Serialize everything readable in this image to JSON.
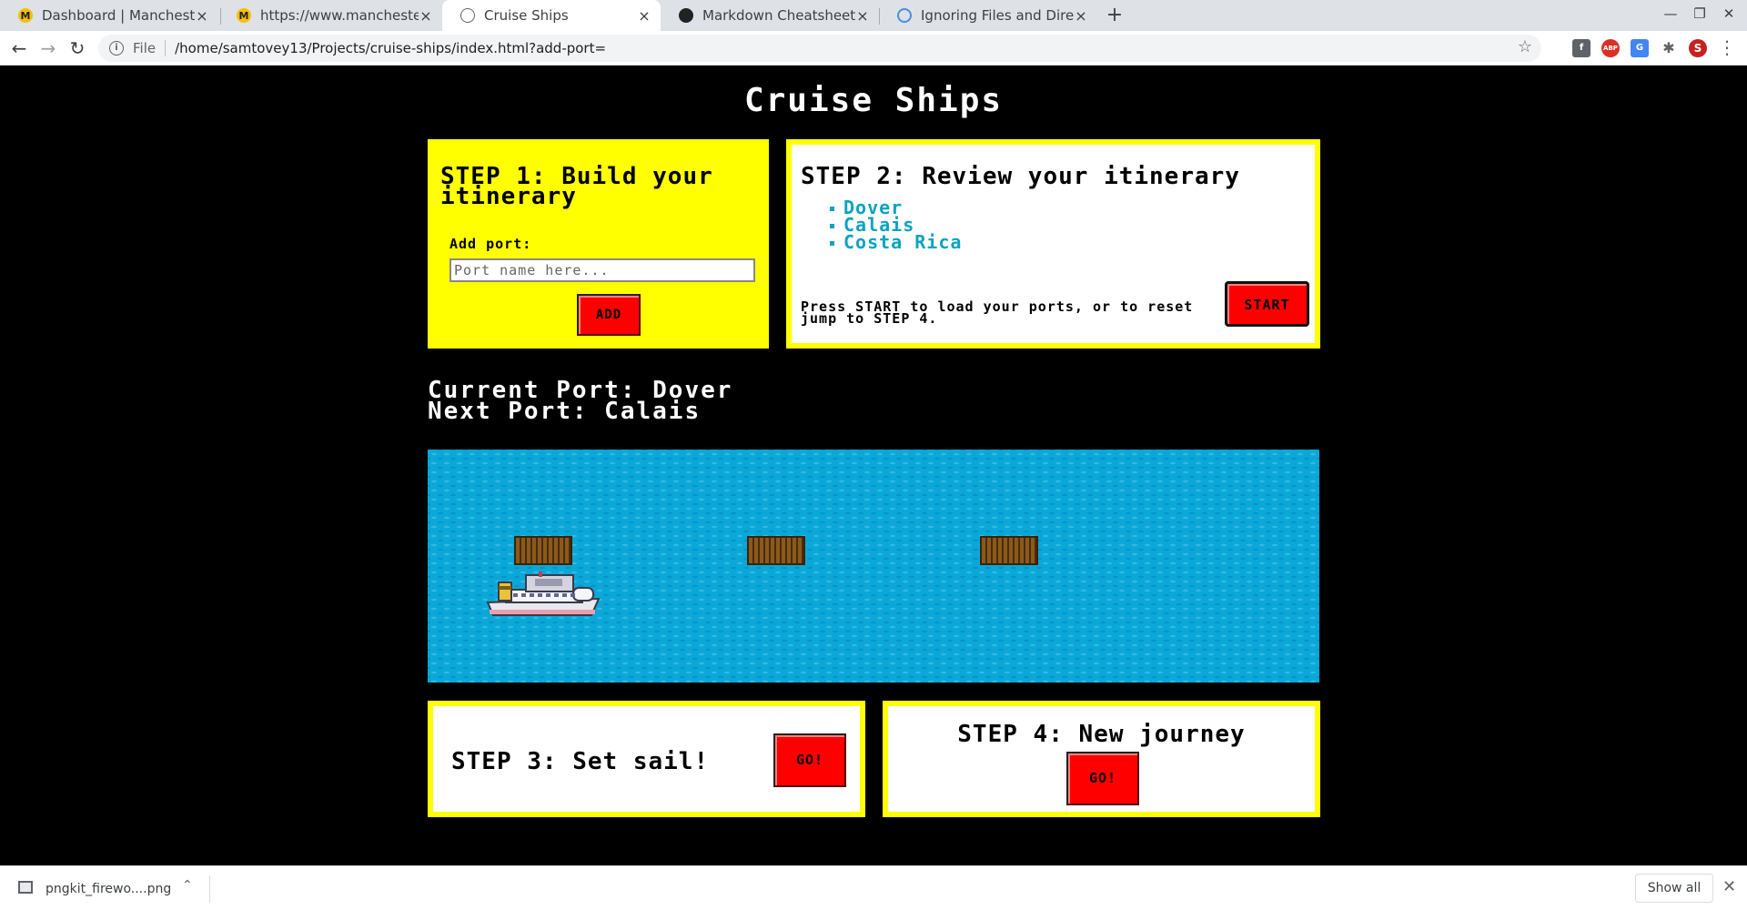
{
  "browser": {
    "tabs": [
      {
        "title": "Dashboard | Manchester Co",
        "favicon": "mcc-logo-icon"
      },
      {
        "title": "https://www.manchesterco",
        "favicon": "mcc-logo-icon"
      },
      {
        "title": "Cruise Ships",
        "favicon": "globe-icon",
        "active": true
      },
      {
        "title": "Markdown Cheatsheet · ad",
        "favicon": "github-icon"
      },
      {
        "title": "Ignoring Files and Director",
        "favicon": "ignore-icon"
      }
    ],
    "omnibox": {
      "scheme_label": "File",
      "url": "/home/samtovey13/Projects/cruise-ships/index.html?add-port="
    },
    "profile_initial": "S",
    "extensions": [
      "facebook-icon",
      "adblock-icon",
      "translate-icon",
      "puzzle-icon"
    ]
  },
  "page": {
    "title": "Cruise Ships",
    "step1": {
      "heading": "STEP 1: Build your itinerary",
      "add_label": "Add port:",
      "input_placeholder": "Port name here...",
      "input_value": "",
      "add_button": "ADD"
    },
    "step2": {
      "heading": "STEP 2: Review your itinerary",
      "ports": [
        "Dover",
        "Calais",
        "Costa Rica"
      ],
      "instructions": "Press START to load your ports, or to reset jump to STEP 4.",
      "start_button": "START"
    },
    "status": {
      "current_port": "Current Port: Dover",
      "next_port": "Next Port: Calais"
    },
    "map": {
      "docks": 3,
      "ship_at_dock": 0
    },
    "step3": {
      "heading": "STEP 3: Set sail!",
      "go_button": "GO!"
    },
    "step4": {
      "heading": "STEP 4: New journey",
      "go_button": "GO!"
    },
    "colors": {
      "panel_yellow": "#ffff00",
      "button_red": "#ff0000",
      "port_list": "#0aa3c2",
      "sea": "#0aa8d8"
    }
  },
  "downloads": {
    "file_name": "pngkit_firewo....png",
    "show_all": "Show all"
  }
}
